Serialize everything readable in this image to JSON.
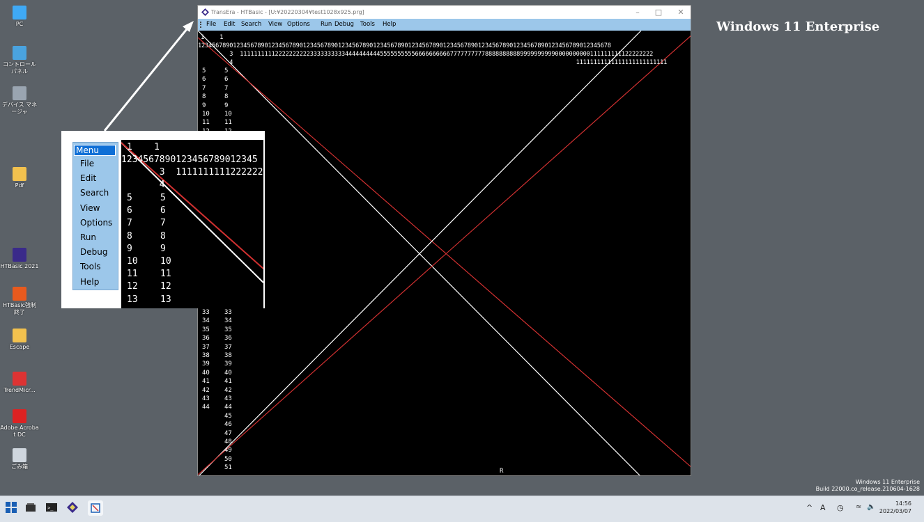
{
  "desktop": {
    "icons": [
      {
        "label": "PC"
      },
      {
        "label": "コントロール パネル"
      },
      {
        "label": "デバイス マネージャ"
      },
      {
        "label": "Pdf"
      },
      {
        "label": "HTBasic 2021"
      },
      {
        "label": "HTBasic強制終了"
      },
      {
        "label": "Escape"
      },
      {
        "label": "TrendMicr..."
      },
      {
        "label": "Adobe Acrobat DC"
      },
      {
        "label": "ごみ箱"
      }
    ],
    "edition_label": "Windows 11 Enterprise",
    "build_line1": "Windows 11 Enterprise",
    "build_line2": "Build 22000.co_release.210604-1628"
  },
  "window": {
    "title": "TransEra - HTBasic - [U:¥20220304¥test1028x925.prg]",
    "menu": [
      "File",
      "Edit",
      "Search",
      "View",
      "Options",
      "Run",
      "Debug",
      "Tools",
      "Help"
    ],
    "console": {
      "header_line1": "1    1",
      "header_line2": "1234567890123456789012345678901234567890123456789012345678901234567890123456789012345678901234567890123456789012345678",
      "header_line3": "         3  1111111111222222222233333333334444444444555555555566666666667777777777888888888899999999990000000000111111111122222222",
      "header_line4": "         4                                                                                                  11111111111111111111111111",
      "rows_top": [
        "5",
        "6",
        "7",
        "8",
        "9",
        "10",
        "11",
        "12"
      ],
      "rows_bottom": [
        "33",
        "34",
        "35",
        "36",
        "37",
        "38",
        "39",
        "40",
        "41",
        "42",
        "43",
        "44"
      ],
      "rows_bottom_right_only": [
        "45",
        "46",
        "47",
        "48",
        "49",
        "50",
        "51"
      ],
      "cursor_char": "R"
    }
  },
  "inset": {
    "menu_title": "Menu",
    "menu_items": [
      "File",
      "Edit",
      "Search",
      "View",
      "Options",
      "Run",
      "Debug",
      "Tools",
      "Help"
    ],
    "zoom_line1": "1    1",
    "zoom_line2": "1234567890123456789012345",
    "zoom_line3": "       3  11111111112222222",
    "zoom_line4": "       4",
    "zoom_rows": [
      "5",
      "6",
      "7",
      "8",
      "9",
      "10",
      "11",
      "12",
      "13"
    ]
  },
  "taskbar": {
    "tray_chevron": "^",
    "ime_indicator": "A",
    "time": "14:56",
    "date": "2022/03/07"
  },
  "colors": {
    "menu_bar": "#9cc7ea",
    "selected_menu": "#0f6fd6",
    "red_line": "#d03030",
    "white_line": "#ffffff"
  }
}
